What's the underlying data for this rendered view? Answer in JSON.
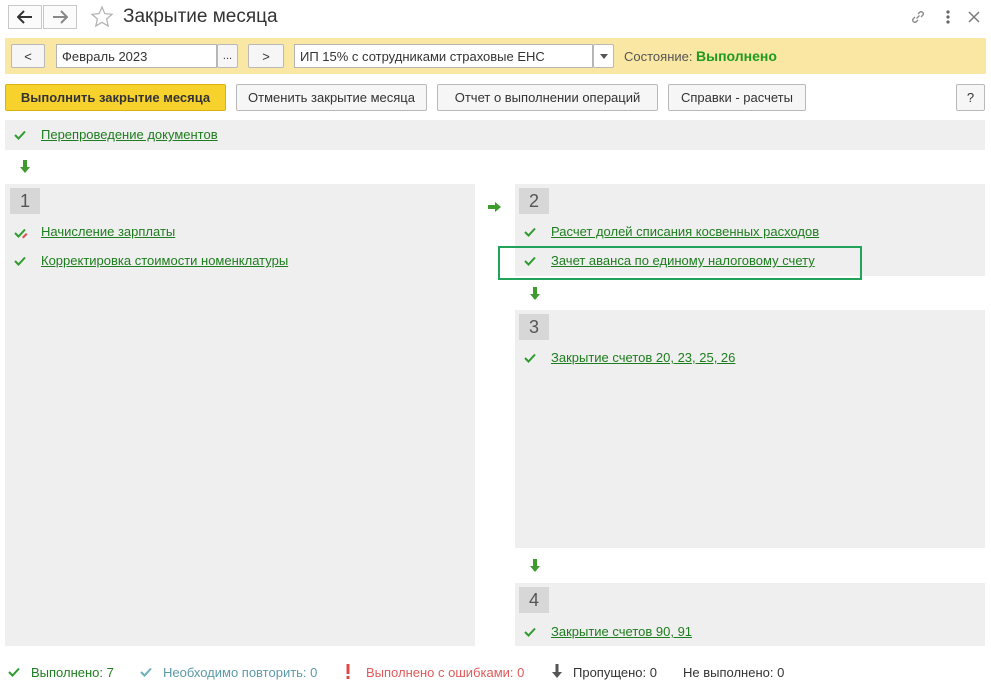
{
  "window": {
    "title": "Закрытие месяца"
  },
  "filter": {
    "prev_label": "<",
    "period_value": "Февраль 2023",
    "period_picker_label": "...",
    "next_label": ">",
    "organization_value": "ИП 15% с сотрудниками страховые ЕНС",
    "state_label": "Состояние:",
    "state_value": "Выполнено"
  },
  "toolbar": {
    "run_label": "Выполнить закрытие месяца",
    "cancel_label": "Отменить закрытие месяца",
    "report_label": "Отчет о выполнении операций",
    "references_label": "Справки - расчеты",
    "help_label": "?"
  },
  "stages": {
    "pre": {
      "items": [
        {
          "label": "Перепроведение документов",
          "status": "done"
        }
      ]
    },
    "stage1": {
      "number": "1",
      "items": [
        {
          "label": "Начисление зарплаты",
          "status": "done-edited"
        },
        {
          "label": "Корректировка стоимости номенклатуры",
          "status": "done"
        }
      ]
    },
    "stage2": {
      "number": "2",
      "items": [
        {
          "label": "Расчет долей списания косвенных расходов",
          "status": "done"
        },
        {
          "label": "Зачет аванса по единому налоговому счету",
          "status": "done",
          "highlighted": true
        }
      ]
    },
    "stage3": {
      "number": "3",
      "items": [
        {
          "label": "Закрытие счетов 20, 23, 25, 26",
          "status": "done"
        }
      ]
    },
    "stage4": {
      "number": "4",
      "items": [
        {
          "label": "Закрытие счетов 90, 91",
          "status": "done"
        }
      ]
    }
  },
  "status_bar": {
    "done": {
      "label": "Выполнено:",
      "count": "7",
      "color": "#1e7d1e"
    },
    "repeat": {
      "label": "Необходимо повторить:",
      "count": "0",
      "color": "#5b9aa8"
    },
    "errors": {
      "label": "Выполнено с ошибками:",
      "count": "0",
      "color": "#e05a5a"
    },
    "skipped": {
      "label": "Пропущено:",
      "count": "0",
      "color": "#333333"
    },
    "not_done": {
      "label": "Не выполнено:",
      "count": "0",
      "color": "#333333"
    }
  },
  "colors": {
    "accent_yellow": "#f7d22d",
    "filter_bar": "#f9e7a3",
    "success_green": "#1e9b1e",
    "highlight_border": "#22a35a"
  }
}
